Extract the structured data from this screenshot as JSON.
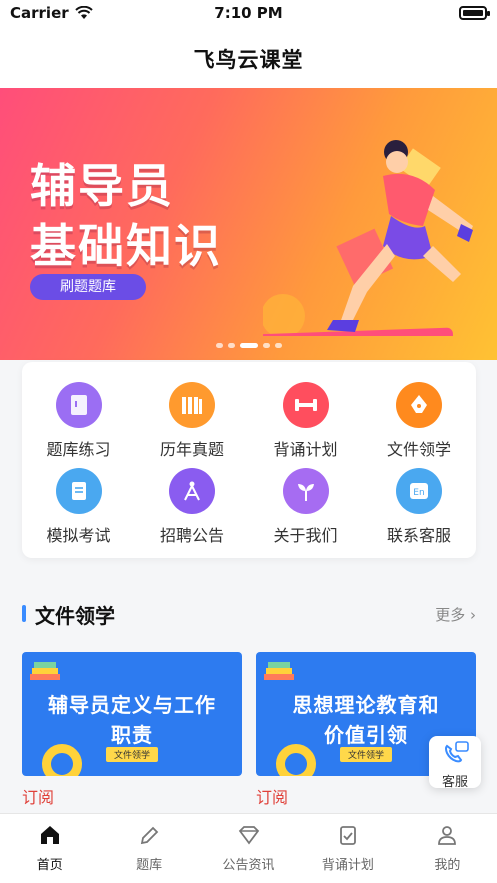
{
  "status": {
    "carrier": "Carrier",
    "time": "7:10 PM"
  },
  "navbar": {
    "title": "飞鸟云课堂"
  },
  "banner": {
    "line1": "辅导员",
    "line2": "基础知识",
    "button": "刷题题库",
    "page_count": 5,
    "active_page": 2
  },
  "grid": [
    {
      "label": "题库练习",
      "icon": "book-icon",
      "color": "#9b6ef3"
    },
    {
      "label": "历年真题",
      "icon": "bookshelf-icon",
      "color": "#ff9a2e"
    },
    {
      "label": "背诵计划",
      "icon": "dumbbell-icon",
      "color": "#ff4e5e"
    },
    {
      "label": "文件领学",
      "icon": "pen-nib-icon",
      "color": "#ff8a1e"
    },
    {
      "label": "模拟考试",
      "icon": "scroll-icon",
      "color": "#4aa8f0"
    },
    {
      "label": "招聘公告",
      "icon": "compass-icon",
      "color": "#8a5cf0"
    },
    {
      "label": "关于我们",
      "icon": "sprout-icon",
      "color": "#a66cf2"
    },
    {
      "label": "联系客服",
      "icon": "translate-icon",
      "color": "#4aa8f0"
    }
  ],
  "section": {
    "title": "文件领学",
    "more": "更多"
  },
  "cards": [
    {
      "title_line1": "辅导员定义与工作",
      "title_line2": "职责",
      "tag": "文件领学",
      "subscribe": "订阅"
    },
    {
      "title_line1": "思想理论教育和",
      "title_line2": "价值引领",
      "tag": "文件领学",
      "subscribe": "订阅"
    }
  ],
  "float_service": {
    "label": "客服"
  },
  "tabbar": [
    {
      "label": "首页",
      "icon": "home-icon",
      "active": true
    },
    {
      "label": "题库",
      "icon": "pencil-icon",
      "active": false
    },
    {
      "label": "公告资讯",
      "icon": "diamond-icon",
      "active": false
    },
    {
      "label": "背诵计划",
      "icon": "clipboard-check-icon",
      "active": false
    },
    {
      "label": "我的",
      "icon": "user-icon",
      "active": false
    }
  ]
}
